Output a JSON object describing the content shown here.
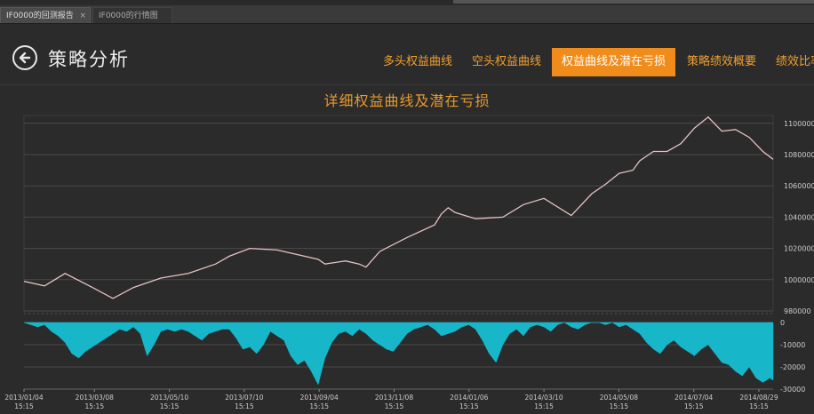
{
  "tabs": [
    {
      "label": "IF0000的回测报告",
      "close": "×"
    },
    {
      "label": "IF0000的行情图"
    }
  ],
  "header": {
    "back_icon": "arrow-left-circle-icon",
    "title": "策略分析"
  },
  "nav": [
    {
      "label": "多头权益曲线"
    },
    {
      "label": "空头权益曲线"
    },
    {
      "label": "权益曲线及潜在亏损",
      "active": true
    },
    {
      "label": "策略绩效概要"
    },
    {
      "label": "绩效比率"
    }
  ],
  "colors": {
    "accent": "#f08c1c",
    "title": "#e89a2c",
    "equity_line": "#e6c2c2",
    "drawdown_fill": "#17b6c9",
    "background": "#2b2b2b",
    "grid": "#4a4a4a"
  },
  "chart_data": {
    "type": "line",
    "title": "详细权益曲线及潜在亏损",
    "x_ticks": [
      "2013/01/04\n15:15",
      "2013/03/08\n15:15",
      "2013/05/10\n15:15",
      "2013/07/10\n15:15",
      "2013/09/04\n15:15",
      "2013/11/08\n15:15",
      "2014/01/06\n15:15",
      "2014/03/10\n15:15",
      "2014/05/08\n15:15",
      "2014/07/04\n15:15",
      "2014/08/29\n15:15"
    ],
    "equity": {
      "ylim": [
        980000,
        1105000
      ],
      "y_ticks": [
        980000,
        1000000,
        1020000,
        1040000,
        1060000,
        1080000,
        1100000
      ],
      "x": [
        0,
        0.3,
        0.6,
        1.0,
        1.3,
        1.6,
        2.0,
        2.4,
        2.8,
        3.0,
        3.3,
        3.7,
        4.0,
        4.3,
        4.4,
        4.7,
        4.9,
        5.0,
        5.2,
        5.6,
        6.0,
        6.1,
        6.2,
        6.3,
        6.6,
        7.0,
        7.3,
        7.6,
        8.0,
        8.3,
        8.5,
        8.7,
        8.9,
        9.0,
        9.2,
        9.4,
        9.6,
        9.8,
        10.0,
        10.2,
        10.4,
        10.6,
        10.8,
        10.95
      ],
      "values": [
        999000,
        996000,
        1004000,
        995000,
        988000,
        995000,
        1001000,
        1004000,
        1010000,
        1015000,
        1020000,
        1019000,
        1016000,
        1013000,
        1010000,
        1012000,
        1010000,
        1008000,
        1018000,
        1027000,
        1035000,
        1042000,
        1046000,
        1043000,
        1039000,
        1040000,
        1048000,
        1052000,
        1041000,
        1055000,
        1061000,
        1068000,
        1070000,
        1076000,
        1082000,
        1082000,
        1087000,
        1097000,
        1104000,
        1095000,
        1096000,
        1091000,
        1082000,
        1077000
      ]
    },
    "drawdown": {
      "ylim": [
        -30000,
        0
      ],
      "y_ticks": [
        0,
        -10000,
        -20000,
        -30000
      ],
      "x": [
        0,
        0.2,
        0.3,
        0.4,
        0.5,
        0.6,
        0.7,
        0.8,
        0.9,
        1.0,
        1.1,
        1.2,
        1.3,
        1.4,
        1.5,
        1.6,
        1.7,
        1.8,
        1.9,
        2.0,
        2.1,
        2.2,
        2.3,
        2.4,
        2.5,
        2.6,
        2.7,
        2.8,
        2.9,
        3.0,
        3.1,
        3.2,
        3.3,
        3.4,
        3.5,
        3.6,
        3.7,
        3.8,
        3.9,
        4.0,
        4.1,
        4.2,
        4.3,
        4.4,
        4.5,
        4.6,
        4.7,
        4.8,
        4.9,
        5.0,
        5.1,
        5.2,
        5.3,
        5.4,
        5.5,
        5.6,
        5.7,
        5.8,
        5.9,
        6.0,
        6.1,
        6.2,
        6.3,
        6.4,
        6.5,
        6.6,
        6.7,
        6.8,
        6.9,
        7.0,
        7.1,
        7.2,
        7.3,
        7.4,
        7.5,
        7.6,
        7.7,
        7.8,
        7.9,
        8.0,
        8.1,
        8.2,
        8.3,
        8.4,
        8.5,
        8.6,
        8.7,
        8.8,
        8.9,
        9.0,
        9.1,
        9.2,
        9.3,
        9.4,
        9.5,
        9.6,
        9.7,
        9.8,
        9.9,
        10.0,
        10.1,
        10.2,
        10.3,
        10.4,
        10.5,
        10.6,
        10.7,
        10.8,
        10.9,
        10.95
      ],
      "values": [
        0,
        -2000,
        -1000,
        -4000,
        -6000,
        -9000,
        -14000,
        -16000,
        -13000,
        -11000,
        -9000,
        -7000,
        -5000,
        -3000,
        -4000,
        -2000,
        -5000,
        -15000,
        -10000,
        -4000,
        -3000,
        -4000,
        -3000,
        -4000,
        -6000,
        -8000,
        -5000,
        -4000,
        -3000,
        -3000,
        -7000,
        -12000,
        -11000,
        -14000,
        -10000,
        -4000,
        -6000,
        -8000,
        -15000,
        -19000,
        -17000,
        -22000,
        -28000,
        -16000,
        -9000,
        -5000,
        -4000,
        -6000,
        -3000,
        -5000,
        -8000,
        -10000,
        -12000,
        -13000,
        -9000,
        -5000,
        -3000,
        -2000,
        -1000,
        -3000,
        -6000,
        -5000,
        -4000,
        -2000,
        -1000,
        -3000,
        -8000,
        -14000,
        -18000,
        -10000,
        -5000,
        -3000,
        -6000,
        -2000,
        -1000,
        -2000,
        -4000,
        -1000,
        0,
        -2000,
        -3000,
        -1000,
        0,
        0,
        -1000,
        0,
        -2000,
        -1000,
        -3000,
        -5000,
        -9000,
        -12000,
        -14000,
        -10000,
        -8000,
        -11000,
        -13000,
        -15000,
        -12000,
        -10000,
        -14000,
        -18000,
        -19000,
        -22000,
        -24000,
        -20000,
        -25000,
        -27000,
        -25000,
        -26000
      ]
    }
  }
}
